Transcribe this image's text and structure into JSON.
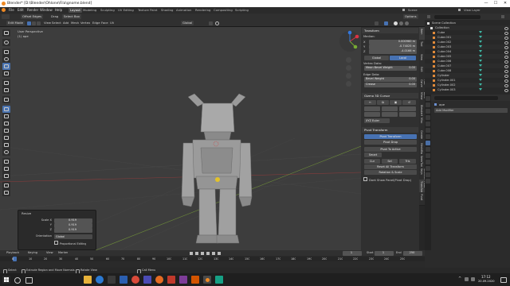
{
  "window": {
    "title": "Blender* [D:\\Blender\\Ohlone\\Fila\\gnome.blend]",
    "controls": [
      "—",
      "☐",
      "✕"
    ]
  },
  "menu": {
    "items": [
      "File",
      "Edit",
      "Render",
      "Window",
      "Help"
    ],
    "workspaces": [
      "Layout",
      "Modeling",
      "Sculpting",
      "UV Editing",
      "Texture Paint",
      "Shading",
      "Animation",
      "Rendering",
      "Compositing",
      "Scripting"
    ],
    "active_workspace": "Layout",
    "scene": "Scene",
    "view_layer": "View Layer"
  },
  "header": {
    "mode": "Edit Mode",
    "menus": [
      "View",
      "Select",
      "Add",
      "Mesh",
      "Vertex",
      "Edge",
      "Face",
      "UV"
    ],
    "orientation": "Global",
    "options": "Options",
    "drag_label": "Drag",
    "select_box": "Select Box",
    "offset_label": "Offset Edges"
  },
  "viewport": {
    "view_name": "User Perspective",
    "object_name": "(1) ape"
  },
  "npanel": {
    "transform_title": "Transform",
    "median_label": "Median:",
    "x": "0.000960 m",
    "y": "-0.74025 m",
    "z": "-4.0166 m",
    "global": "Global",
    "local": "Local",
    "vertex_data": "Vertex Data:",
    "mean_bevel_weight": "Mean Bevel Weight",
    "mean_bevel_value": "0.00",
    "edge_data": "Edge Data:",
    "bevel_weight": "Bevel Weight",
    "bevel_weight_value": "0.00",
    "crease": "Crease",
    "crease_value": "0.00",
    "cursor_title": "Gizmo 3D Cursor",
    "xyz_euler": "XYZ Euler",
    "pivot_title": "Pivot Transform",
    "pivot_transform": "Pivot Transform",
    "pivot_drop": "Pivot Drop",
    "pivot_to_active": "Pivot To Active",
    "smart": "Smart",
    "cur": "Cur",
    "sel": "Sel",
    "tris": "Tris",
    "reset_all": "Reset All Transform",
    "rotation_scale": "Rotation & Scale",
    "dont_show": "Dont Show Panel(Pivot Drop)",
    "tabs": [
      "Item",
      "Tool",
      "View",
      "Edit",
      "Fast Carve",
      "Auto Mirror",
      "BlenderKit",
      "Misc",
      "Create",
      "MeshMachine",
      "KeenTools",
      "Screencast Keys",
      "Pivot Transform",
      "Pivot"
    ]
  },
  "outliner": {
    "header": "Scene Collection",
    "items": [
      "Collection",
      "Cube",
      "Cube.001",
      "Cube.002",
      "Cube.003",
      "Cube.004",
      "Cube.005",
      "Cube.006",
      "Cube.007",
      "Cube.008",
      "Cylinder",
      "Cylinder.001",
      "Cylinder.002",
      "Cylinder.003"
    ]
  },
  "properties": {
    "object_name": "ape",
    "add_modifier": "Add Modifier"
  },
  "redo": {
    "title": "Resize",
    "scale_x_label": "Scale X",
    "scale_x": "0.919",
    "y_label": "Y",
    "y": "0.919",
    "z_label": "Z",
    "z": "0.919",
    "orientation_label": "Orientation",
    "orientation": "Global",
    "proportional": "Proportional Editing"
  },
  "timeline": {
    "menus": [
      "Playback",
      "Keying",
      "View",
      "Marker"
    ],
    "current_frame": "1",
    "start_label": "Start",
    "start": "1",
    "end_label": "End",
    "end": "250",
    "ticks": [
      "0",
      "10",
      "20",
      "30",
      "40",
      "50",
      "60",
      "70",
      "80",
      "90",
      "100",
      "110",
      "120",
      "130",
      "140",
      "150",
      "160",
      "170",
      "180",
      "190",
      "200",
      "210",
      "220",
      "230",
      "240",
      "250"
    ]
  },
  "status": {
    "select": "Select",
    "extrude": "Extrude Region and Move Normals",
    "rotate": "Rotate View",
    "call_menu": "Call Menu"
  },
  "taskbar": {
    "time": "17:12",
    "date": "20.09.2020"
  },
  "colors": {
    "accent": "#4772b3",
    "viewport_bg": "#3d3d3d",
    "orange_icon": "#e08a3a",
    "teal_icon": "#3fb9a6"
  }
}
